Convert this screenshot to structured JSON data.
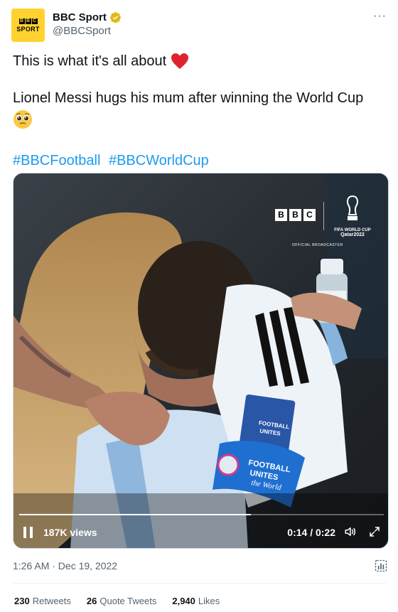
{
  "author": {
    "avatar_blocks": [
      "B",
      "B",
      "C"
    ],
    "avatar_word": "SPORT",
    "display_name": "BBC Sport",
    "handle": "@BBCSport",
    "brand_color": "#ffd230",
    "verified_color": "#e2b719"
  },
  "more_label": "···",
  "tweet": {
    "line1": "This is what it's all about",
    "line1_emoji": "❤️",
    "line2": "Lionel Messi hugs his mum after winning the World Cup",
    "line2_emoji": "🥹",
    "hashtags": [
      "#BBCFootball",
      "#BBCWorldCup"
    ]
  },
  "media": {
    "overlay_logo": [
      "B",
      "B",
      "C"
    ],
    "fifa_line_a": "FIFA WORLD CUP",
    "fifa_line_b": "Qatar2022",
    "official_text": "OFFICIAL BROADCASTER",
    "armband_text_1": "FOOTBALL",
    "armband_text_2": "UNITES",
    "armband_text_3": "the World",
    "progress_fraction": 0.636
  },
  "video_controls": {
    "views": "187K views",
    "time": "0:14 / 0:22",
    "pause_icon": "pause-icon",
    "volume_icon": "volume-icon",
    "expand_icon": "expand-icon"
  },
  "timestamp": "1:26 AM · Dec 19, 2022",
  "stats": [
    {
      "num": "230",
      "label": "Retweets"
    },
    {
      "num": "26",
      "label": "Quote Tweets"
    },
    {
      "num": "2,940",
      "label": "Likes"
    }
  ],
  "colors": {
    "link": "#1d9bf0",
    "muted": "#536471",
    "heart": "#f4212e"
  }
}
